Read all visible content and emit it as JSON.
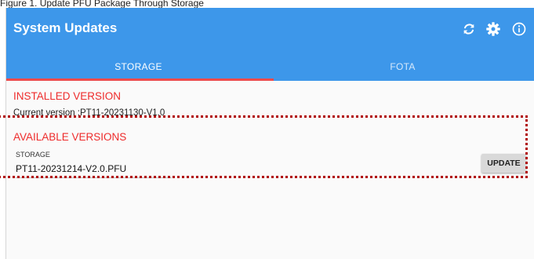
{
  "caption": "Figure 1. Update PFU Package Through Storage",
  "appbar": {
    "title": "System Updates",
    "icons": [
      "sync-icon",
      "gear-icon",
      "info-icon"
    ]
  },
  "tabs": [
    {
      "label": "STORAGE",
      "active": true
    },
    {
      "label": "FOTA",
      "active": false
    }
  ],
  "installed": {
    "heading": "INSTALLED VERSION",
    "current": "Current version :PT11-20231130-V1.0"
  },
  "available": {
    "heading": "AVAILABLE VERSIONS",
    "source_label": "STORAGE",
    "file": "PT11-20231214-V2.0.PFU",
    "button": "UPDATE"
  },
  "colors": {
    "appbar": "#3d97ea",
    "indicator": "#ef4b4b",
    "heading": "#ee2b2b",
    "highlight": "#b00000"
  }
}
